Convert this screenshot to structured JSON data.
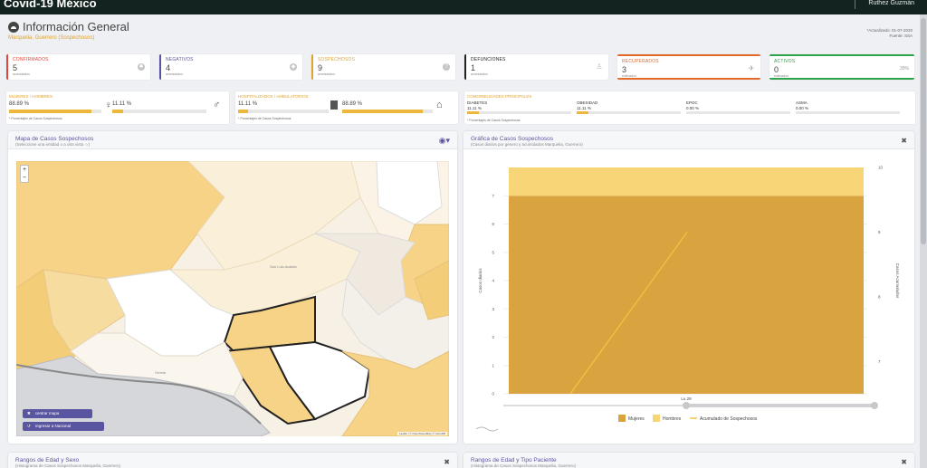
{
  "app": {
    "brand": "Covid-19 México",
    "user": "Ruthez Guzmán"
  },
  "header": {
    "title": "Información General",
    "subtitle": "Marquelia, Guerrero (Sospechosos)",
    "updated": "*Actualizado: 01-07-2020",
    "source": "Fuente: SSA"
  },
  "stats": [
    {
      "label": "CONFIRMADOS",
      "value": "5",
      "sub": "acumulados",
      "color": "#e0463a",
      "icon": "virus-icon"
    },
    {
      "label": "NEGATIVOS",
      "value": "4",
      "sub": "acumulados",
      "color": "#5a55a0",
      "icon": "shield-icon"
    },
    {
      "label": "SOSPECHOSOS",
      "value": "9",
      "sub": "acumulados",
      "color": "#e2a32a",
      "icon": "question-icon"
    },
    {
      "label": "DEFUNCIONES",
      "value": "1",
      "sub": "acumulados",
      "color": "#222222",
      "icon": "person-icon"
    },
    {
      "label": "RECUPERADOS",
      "value": "3",
      "sub": "estimados",
      "color": "#e66a2c",
      "icon": "runner-icon"
    },
    {
      "label": "ACTIVOS",
      "value": "0",
      "sub": "estimados",
      "color": "#2ea34a",
      "icon": "chart-icon",
      "extra": "39%"
    }
  ],
  "gender": {
    "header": "MUJERES / HOMBRES",
    "women_pct": "88.89 %",
    "women_value": 0.8889,
    "men_pct": "11.11 %",
    "men_value": 0.1111,
    "footnote": "* Porcentajes de Casos Sospechosos"
  },
  "hospital": {
    "header": "HOSPITALIZADOS / AMBULATORIOS",
    "hosp_pct": "11.11 %",
    "hosp_value": 0.1111,
    "amb_pct": "88.89 %",
    "amb_value": 0.8889,
    "footnote": "* Porcentajes de Casos Sospechosos"
  },
  "comorb": {
    "header": "COMORBILIDADES PRINCIPALES",
    "items": [
      {
        "name": "DIABETES",
        "pct": "11.11 %",
        "value": 0.1111
      },
      {
        "name": "OBESIDAD",
        "pct": "11.11 %",
        "value": 0.1111
      },
      {
        "name": "EPOC",
        "pct": "0.00 %",
        "value": 0
      },
      {
        "name": "ASMA",
        "pct": "0.00 %",
        "value": 0
      }
    ],
    "footnote": "* Porcentajes de Casos Sospechosos"
  },
  "map": {
    "title": "Mapa de Casos Sospechosos",
    "subtitle": "(Seleccione una entidad o a otra vista ☆)",
    "zoom_in": "+",
    "zoom_out": "−",
    "btn_center": "centrar mapa",
    "btn_back": "regresar a Nacional",
    "place_label": "San Luis Acatlán",
    "place_label2": "Ometa",
    "attribution": "Leaflet | © OpenStreetMap © CartoDB"
  },
  "graph": {
    "title": "Gráfica de Casos Sospechosos",
    "subtitle": "(Casos diarios por género y acumulados Marquelia, Guerrero)",
    "left_axis_label": "Casos diarios",
    "right_axis_label": "Casos Acumulados",
    "legend_women": "Mujeres",
    "legend_men": "Hombres",
    "legend_cum": "Acumulado de Sospechosos",
    "color_women": "#d9a440",
    "color_men": "#f8d577",
    "color_cum": "#f2c541"
  },
  "chart_data": {
    "type": "bar",
    "categories": [
      "Lu 29"
    ],
    "series": [
      {
        "name": "Mujeres",
        "values": [
          7
        ]
      },
      {
        "name": "Hombres",
        "values": [
          1
        ]
      },
      {
        "name": "Acumulado de Sospechosos",
        "values": [
          9
        ]
      }
    ],
    "ylim": [
      0,
      8
    ],
    "ylim_right": [
      0,
      10
    ],
    "left_ticks": [
      "0",
      "1",
      "2",
      "3",
      "4",
      "5",
      "6",
      "7"
    ],
    "right_ticks": [
      "7",
      "8",
      "9",
      "10"
    ]
  },
  "bottom_left": {
    "title": "Rangos de Edad y Sexo",
    "subtitle": "(Histograma de Casos Sospechosos Marquelia, Guerrero)"
  },
  "bottom_right": {
    "title": "Rangos de Edad y Tipo Paciente",
    "subtitle": "(Histograma de Casos Sospechosos Marquelia, Guerrero)"
  }
}
